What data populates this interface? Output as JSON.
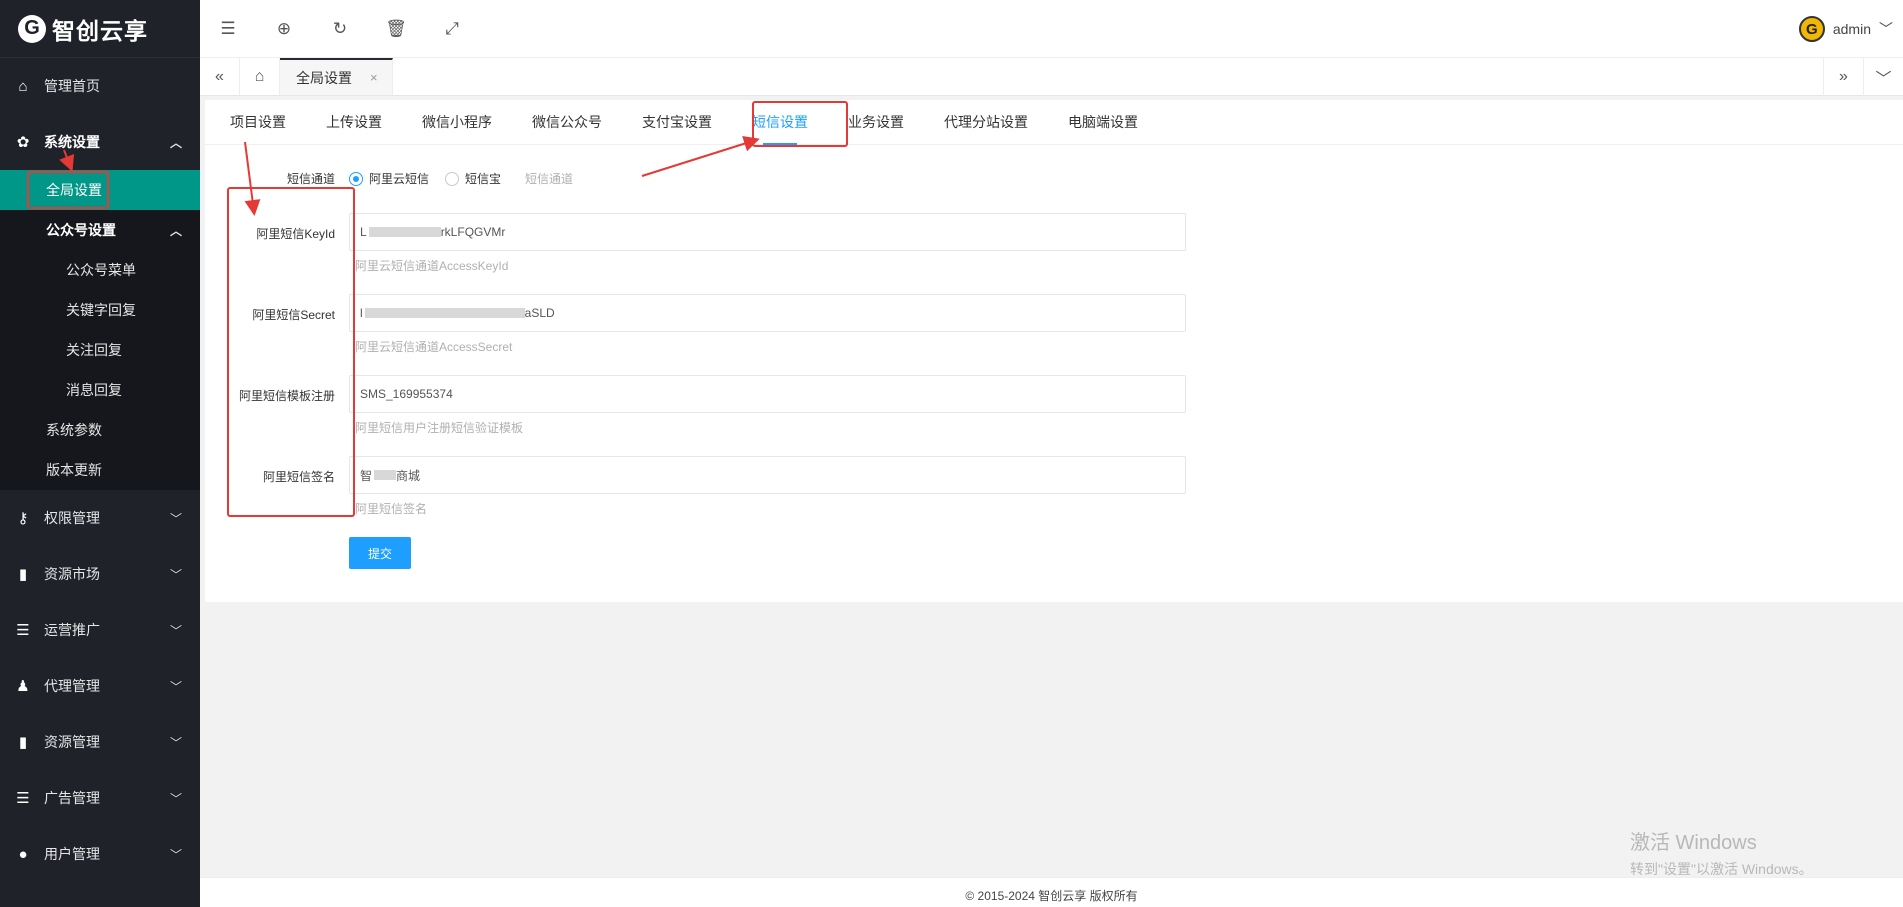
{
  "brand": {
    "logo_text": "智创云享",
    "logo_letter": "G"
  },
  "sidebar": {
    "home": "管理首页",
    "system": "系统设置",
    "global_settings": "全局设置",
    "mp_settings": "公众号设置",
    "mp_menu": "公众号菜单",
    "keyword_reply": "关键字回复",
    "follow_reply": "关注回复",
    "message_reply": "消息回复",
    "system_params": "系统参数",
    "version_update": "版本更新",
    "permissions": "权限管理",
    "resource_market": "资源市场",
    "operations": "运营推广",
    "agents": "代理管理",
    "resources": "资源管理",
    "ads": "广告管理",
    "users": "用户管理"
  },
  "header": {
    "username": "admin",
    "avatar_letter": "G"
  },
  "tabbar": {
    "current_tab": "全局设置",
    "close": "×"
  },
  "subtabs": {
    "project": "项目设置",
    "upload": "上传设置",
    "miniprogram": "微信小程序",
    "official": "微信公众号",
    "alipay": "支付宝设置",
    "sms": "短信设置",
    "business": "业务设置",
    "agent_site": "代理分站设置",
    "pc": "电脑端设置"
  },
  "form": {
    "channel": {
      "label": "短信通道",
      "option_aliyun": "阿里云短信",
      "option_dxb": "短信宝",
      "hint": "短信通道"
    },
    "keyid": {
      "label": "阿里短信KeyId",
      "value_prefix": "L",
      "value_suffix": "rkLFQGVMr",
      "help": "阿里云短信通道AccessKeyId"
    },
    "secret": {
      "label": "阿里短信Secret",
      "value_prefix": "l",
      "value_suffix": "aSLD",
      "help": "阿里云短信通道AccessSecret"
    },
    "template": {
      "label": "阿里短信模板注册",
      "value": "SMS_169955374",
      "help": "阿里短信用户注册短信验证模板"
    },
    "sign": {
      "label": "阿里短信签名",
      "value_prefix": "智",
      "value_suffix": "商城",
      "help": "阿里短信签名"
    },
    "submit": "提交"
  },
  "watermark": {
    "line1": "激活 Windows",
    "line2": "转到\"设置\"以激活 Windows。"
  },
  "footer": {
    "copyright": "© 2015-2024 智创云享 版权所有"
  },
  "colors": {
    "sidebar_bg": "#20222a",
    "active_teal": "#009688",
    "accent_blue": "#1e9fff",
    "annotation_red": "#e53935"
  },
  "icons": {
    "sidebar": [
      "home-icon",
      "gear-icon",
      "key-icon",
      "bookmark-icon",
      "list-icon",
      "agent-icon",
      "bookmark-icon",
      "list-icon",
      "user-icon"
    ],
    "header": [
      "menu-fold-icon",
      "globe-icon",
      "refresh-icon",
      "trash-icon",
      "fullscreen-icon"
    ]
  }
}
